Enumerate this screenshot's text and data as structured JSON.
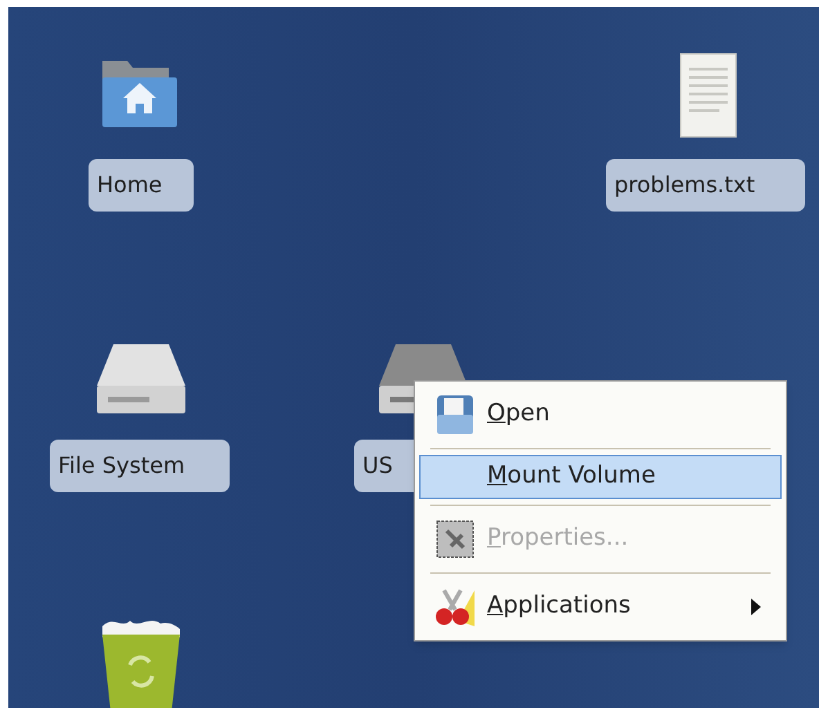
{
  "desktop_icons": [
    {
      "kind": "home",
      "label": "Home"
    },
    {
      "kind": "text-file",
      "label": "problems.txt"
    },
    {
      "kind": "drive",
      "label": "File System"
    },
    {
      "kind": "drive-dark",
      "label": "US"
    },
    {
      "kind": "trash"
    }
  ],
  "context_menu": {
    "items": [
      {
        "label": "Open",
        "kind": "open",
        "selected": false,
        "disabled": false,
        "submenu": false
      },
      {
        "label": "Mount Volume",
        "kind": "plain",
        "selected": true,
        "disabled": false,
        "submenu": false
      },
      {
        "label": "Properties...",
        "kind": "properties",
        "selected": false,
        "disabled": true,
        "submenu": false
      },
      {
        "label": "Applications",
        "kind": "applications",
        "selected": false,
        "disabled": false,
        "submenu": true
      }
    ]
  }
}
